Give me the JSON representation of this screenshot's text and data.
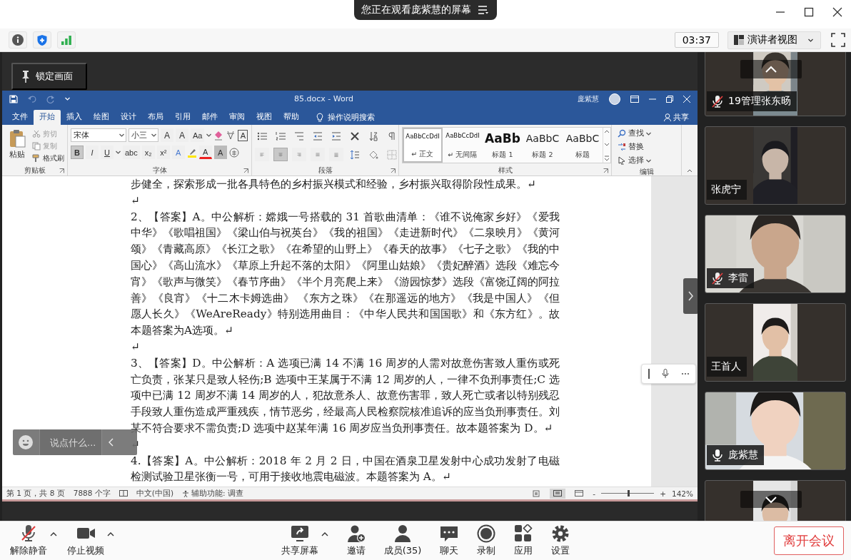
{
  "banner": {
    "text": "您正在观看庞紫慧的屏幕"
  },
  "toolbar": {
    "timer": "03:37",
    "view_button": "演讲者视图"
  },
  "shared_screen": {
    "lock_button": "锁定画面",
    "chat": {
      "placeholder": "说点什么..."
    },
    "word": {
      "title": "85.docx - Word",
      "user": "庞紫慧",
      "tabs": [
        {
          "label": "文件",
          "selected": false
        },
        {
          "label": "开始",
          "selected": true
        },
        {
          "label": "插入",
          "selected": false
        },
        {
          "label": "绘图",
          "selected": false
        },
        {
          "label": "设计",
          "selected": false
        },
        {
          "label": "布局",
          "selected": false
        },
        {
          "label": "引用",
          "selected": false
        },
        {
          "label": "邮件",
          "selected": false
        },
        {
          "label": "审阅",
          "selected": false
        },
        {
          "label": "视图",
          "selected": false
        },
        {
          "label": "帮助",
          "selected": false
        }
      ],
      "search_hint": "操作说明搜索",
      "share": "共享",
      "clipboard": {
        "paste": "粘贴",
        "items": [
          {
            "label": "剪切",
            "disabled": true
          },
          {
            "label": "复制",
            "disabled": true
          },
          {
            "label": "格式刷",
            "disabled": false
          }
        ],
        "label": "剪贴板"
      },
      "font": {
        "name": "宋体",
        "size": "小三",
        "label": "字体",
        "size_buttons": [
          {
            "label": "A",
            "kind": "grow"
          },
          {
            "label": "A",
            "kind": "shrink"
          },
          {
            "label": "Aa",
            "kind": "case"
          },
          {
            "label": "A",
            "kind": "border"
          }
        ],
        "format_buttons": [
          {
            "label": "B",
            "selected": true
          },
          {
            "label": "I",
            "selected": false
          },
          {
            "label": "U",
            "selected": false
          },
          {
            "label": "abc",
            "selected": false
          },
          {
            "label": "x₂",
            "selected": false
          },
          {
            "label": "x²",
            "selected": false
          }
        ],
        "effect_buttons": [
          {
            "label": "A",
            "kind": "effect"
          },
          {
            "label": "A",
            "kind": "color"
          },
          {
            "label": "A",
            "kind": "shade"
          }
        ]
      },
      "paragraph": {
        "label": "段落",
        "align_buttons": [
          {
            "selected": false
          },
          {
            "selected": true
          },
          {
            "selected": false
          },
          {
            "selected": false
          },
          {
            "selected": false
          }
        ]
      },
      "styles": {
        "label": "样式",
        "items": [
          {
            "preview": "AaBbCcDdI",
            "name": "↵ 正文",
            "kind": "body",
            "selected": true
          },
          {
            "preview": "AaBbCcDdI",
            "name": "↵ 无间隔",
            "kind": "body",
            "selected": false
          },
          {
            "preview": "AaBb",
            "name": "标题 1",
            "kind": "h1",
            "selected": false
          },
          {
            "preview": "AaBbC",
            "name": "标题 2",
            "kind": "h2",
            "selected": false
          },
          {
            "preview": "AaBbC",
            "name": "标题",
            "kind": "h2",
            "selected": false
          }
        ]
      },
      "editing": {
        "label": "编辑",
        "items": [
          {
            "label": "查找",
            "kind": "find"
          },
          {
            "label": "替换",
            "kind": "replace"
          },
          {
            "label": "选择",
            "kind": "select"
          }
        ]
      },
      "paragraphs": [
        "步健全，探索形成一批各具特色的乡村振兴模式和经验，乡村振兴取得阶段性成果。↵",
        "↵",
        "2、【答案】A。中公解析：嫦娥一号搭载的 31 首歌曲清单：《谁不说俺家乡好》《爱我中华》《歌唱祖国》《梁山伯与祝英台》《我的祖国》《走进新时代》《二泉映月》《黄河颂》《青藏高原》《长江之歌》《在希望的山野上》《春天的故事》《七子之歌》《我的中国心》《高山流水》《草原上升起不落的太阳》《阿里山姑娘》《贵妃醉酒》选段《难忘今宵》《歌声与微笑》《春节序曲》《半个月亮爬上来》《游园惊梦》选段《富饶辽阔的阿拉善》《良宵》《十二木卡姆选曲》 《东方之珠》《在那遥远的地方》《我是中国人》《但愿人长久》《WeAreReady》特别选用曲目：《中华人民共和国国歌》和《东方红》。故本题答案为A选项。↵",
        "↵",
        "3、【答案】D。中公解析：A 选项已满 14 不满 16 周岁的人需对故意伤害致人重伤或死亡负责，张某只是致人轻伤;B 选项中王某属于不满 12 周岁的人，一律不负刑事责任;C 选项中已满 12 周岁不满 14 周岁的人，犯故意杀人、故意伤害罪，致人死亡或者以特别残忍手段致人重伤造成严重残疾，情节恶劣，经最高人民检察院核准追诉的应当负刑事责任。刘某不符合要求不需负责;D 选项中赵某年满 16 周岁应当负刑事责任。故本题答案为 D。↵",
        "↵",
        "4.【答案】A。中公解析：2018 年 2 月 2 日，中国在酒泉卫星发射中心成功发射了电磁检测试验卫星张衡一号，可用于接收地震电磁波。本题答案为 A。↵"
      ],
      "status_bar": {
        "page": "第 1 页，共 8 页",
        "words": "7888 个字",
        "language": "中文(中国)",
        "accessibility": "辅助功能: 调查",
        "zoom_out": "-",
        "zoom_in": "+",
        "zoom": "142%",
        "zoom_slider": {
          "level": 0.5
        }
      }
    }
  },
  "participants": [
    {
      "name": "19管理张东旸",
      "kind": "muted",
      "video_wide": false
    },
    {
      "name": "张虎宁",
      "kind": "plain",
      "video_wide": false
    },
    {
      "name": "李雷",
      "kind": "muted",
      "video_wide": true
    },
    {
      "name": "王首人",
      "kind": "plain",
      "video_wide": false
    },
    {
      "name": "庞紫慧",
      "kind": "unmuted",
      "video_wide": true
    },
    {
      "kind": "plain",
      "video_wide": false
    }
  ],
  "bottom_bar": {
    "left": [
      {
        "label": "解除静音",
        "kind": "mic-muted",
        "caret": true
      },
      {
        "label": "停止视频",
        "kind": "video",
        "caret": true
      }
    ],
    "center": [
      {
        "label": "共享屏幕",
        "kind": "share",
        "caret": true
      },
      {
        "label": "邀请",
        "kind": "invite",
        "caret": false
      },
      {
        "label": "成员(35)",
        "kind": "members",
        "caret": false
      },
      {
        "label": "聊天",
        "kind": "chat",
        "caret": false
      },
      {
        "label": "录制",
        "kind": "record",
        "caret": false
      },
      {
        "label": "应用",
        "kind": "apps",
        "caret": false
      },
      {
        "label": "设置",
        "kind": "settings",
        "caret": false
      }
    ],
    "leave_button": "离开会议"
  }
}
